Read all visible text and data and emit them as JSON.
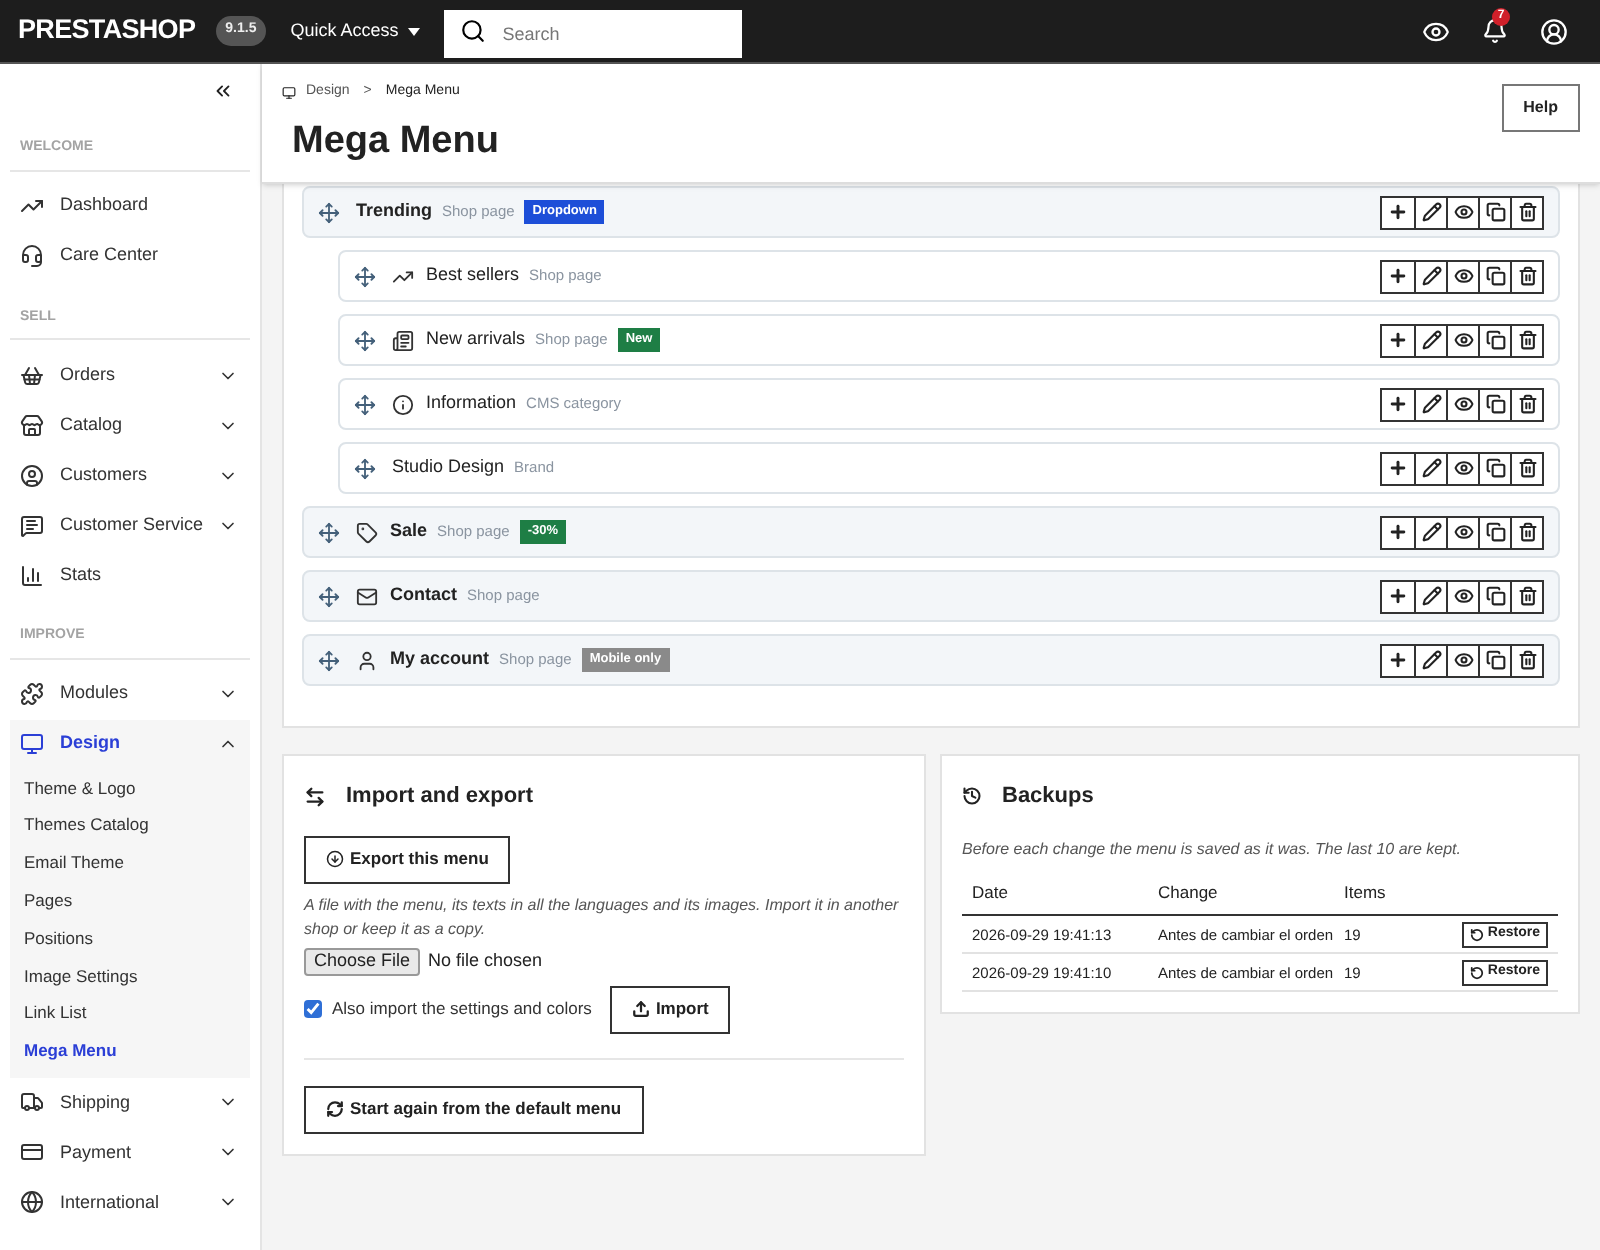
{
  "topbar": {
    "logo": "PRESTASHOP",
    "version": "9.1.5",
    "quick_access": "Quick Access",
    "search": {
      "placeholder": "Search"
    },
    "notifications": "7"
  },
  "sidebar": {
    "sections": [
      {
        "title": "WELCOME",
        "items": [
          {
            "label": "Dashboard",
            "expandable": false,
            "expanded": false,
            "selected": false
          },
          {
            "label": "Care Center",
            "expandable": false,
            "expanded": false,
            "selected": false
          }
        ]
      },
      {
        "title": "SELL",
        "items": [
          {
            "label": "Orders",
            "expandable": true,
            "expanded": false,
            "selected": false
          },
          {
            "label": "Catalog",
            "expandable": true,
            "expanded": false,
            "selected": false
          },
          {
            "label": "Customers",
            "expandable": true,
            "expanded": false,
            "selected": false
          },
          {
            "label": "Customer Service",
            "expandable": true,
            "expanded": false,
            "selected": false
          },
          {
            "label": "Stats",
            "expandable": false,
            "expanded": false,
            "selected": false
          }
        ]
      },
      {
        "title": "IMPROVE",
        "items": [
          {
            "label": "Modules",
            "expandable": true,
            "expanded": false,
            "selected": false
          },
          {
            "label": "Design",
            "expandable": true,
            "expanded": true,
            "selected": true,
            "children": [
              {
                "label": "Theme & Logo",
                "selected": false
              },
              {
                "label": "Themes Catalog",
                "selected": false
              },
              {
                "label": "Email Theme",
                "selected": false
              },
              {
                "label": "Pages",
                "selected": false
              },
              {
                "label": "Positions",
                "selected": false
              },
              {
                "label": "Image Settings",
                "selected": false
              },
              {
                "label": "Link List",
                "selected": false
              },
              {
                "label": "Mega Menu",
                "selected": true
              }
            ]
          },
          {
            "label": "Shipping",
            "expandable": true,
            "expanded": false,
            "selected": false
          },
          {
            "label": "Payment",
            "expandable": true,
            "expanded": false,
            "selected": false
          },
          {
            "label": "International",
            "expandable": true,
            "expanded": false,
            "selected": false
          }
        ]
      }
    ]
  },
  "breadcrumb": [
    "Design",
    "Mega Menu"
  ],
  "breadcrumb_separator": ">",
  "title": "Mega Menu",
  "help_button": "Help",
  "menu_items": [
    {
      "label": "Trending",
      "type": "Shop page",
      "badge": {
        "text": "Dropdown",
        "color": "#1d4ed8"
      },
      "children": [
        {
          "label": "Best sellers",
          "type": "Shop page"
        },
        {
          "label": "New arrivals",
          "type": "Shop page",
          "badge": {
            "text": "New",
            "color": "#1e7e45"
          }
        },
        {
          "label": "Information",
          "type": "CMS category"
        },
        {
          "label": "Studio Design",
          "type": "Brand"
        }
      ]
    },
    {
      "label": "Sale",
      "type": "Shop page",
      "badge": {
        "text": "-30%",
        "color": "#1e7e45"
      }
    },
    {
      "label": "Contact",
      "type": "Shop page"
    },
    {
      "label": "My account",
      "type": "Shop page",
      "badge": {
        "text": "Mobile only",
        "color": "#8a8a8a"
      }
    }
  ],
  "import_export": {
    "title": "Import and export",
    "export_button": "Export this menu",
    "description": "A file with the menu, its texts in all the languages and its images. Import it in another shop or keep it as a copy.",
    "file_button": "Choose File",
    "file_status": "No file chosen",
    "also_import": {
      "label": "Also import the settings and colors",
      "checked": true
    },
    "import_button": "Import",
    "reset_button": "Start again from the default menu"
  },
  "backups": {
    "title": "Backups",
    "description": "Before each change the menu is saved as it was. The last 10 are kept.",
    "columns": [
      "Date",
      "Change",
      "Items"
    ],
    "rows": [
      {
        "date": "2026-09-29 19:41:13",
        "change": "Antes de cambiar el orden",
        "items": "19",
        "action": "Restore"
      },
      {
        "date": "2026-09-29 19:41:10",
        "change": "Antes de cambiar el orden",
        "items": "19",
        "action": "Restore"
      }
    ]
  }
}
